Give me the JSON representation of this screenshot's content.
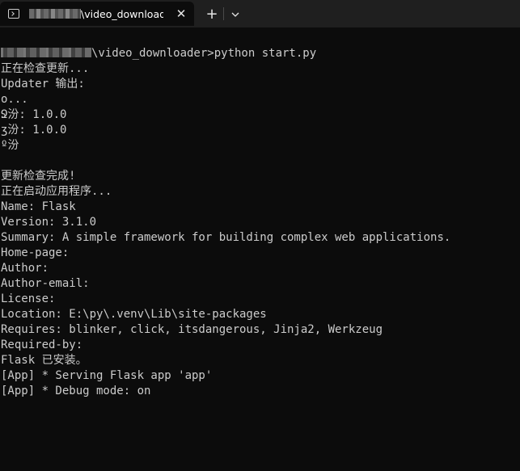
{
  "tab": {
    "title": "\\video_downloade",
    "close_glyph": "✕"
  },
  "titlebar": {
    "new_tab_glyph": "+",
    "dropdown_glyph": "⌄"
  },
  "terminal": {
    "prompt_suffix": "\\video_downloader>python start.py",
    "lines": [
      "正在检查更新...",
      "Updater 输出:",
      "ο...",
      "Ջ汾: 1.0.0",
      "ʒ汾: 1.0.0",
      "º汾",
      "",
      "更新检查完成!",
      "正在启动应用程序...",
      "Name: Flask",
      "Version: 3.1.0",
      "Summary: A simple framework for building complex web applications.",
      "Home-page:",
      "Author:",
      "Author-email:",
      "License:",
      "Location: E:\\py\\.venv\\Lib\\site-packages",
      "Requires: blinker, click, itsdangerous, Jinja2, Werkzeug",
      "Required-by:",
      "Flask 已安装。",
      "[App] * Serving Flask app 'app'",
      "[App] * Debug mode: on"
    ]
  },
  "colors": {
    "background": "#0c0c0c",
    "titlebar": "#1f1f1f",
    "text": "#cccccc"
  }
}
